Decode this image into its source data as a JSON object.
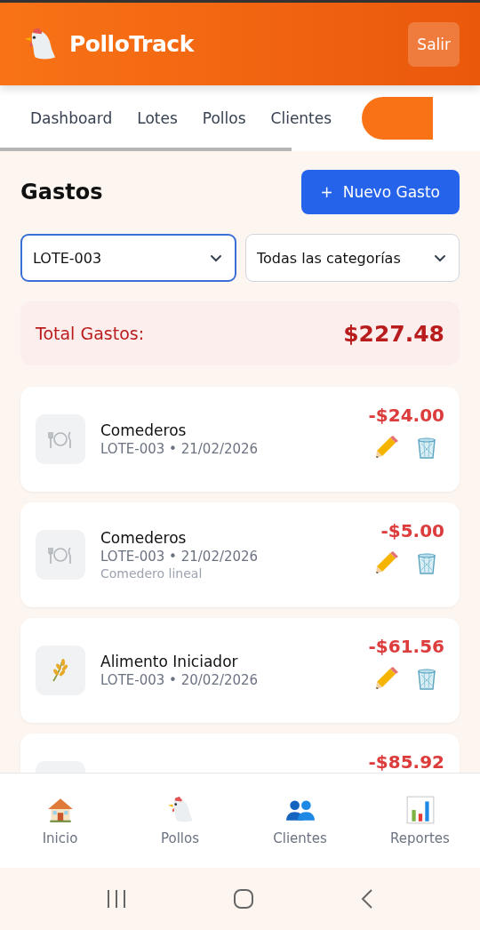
{
  "header": {
    "title": "PolloTrack",
    "logout": "Salir"
  },
  "tabs": [
    {
      "label": "Dashboard",
      "selected": false
    },
    {
      "label": "Lotes",
      "selected": false
    },
    {
      "label": "Pollos",
      "selected": false
    },
    {
      "label": "Clientes",
      "selected": false
    },
    {
      "selected": true
    }
  ],
  "page": {
    "title": "Gastos",
    "new_button": "+  Nuevo Gasto"
  },
  "filters": [
    {
      "value": "LOTE-003",
      "focused": true
    },
    {
      "value": "Todas las categorías",
      "focused": false
    }
  ],
  "total": {
    "label": "Total Gastos:",
    "value": "$227.48"
  },
  "expenses": [
    {
      "kind": "utensils",
      "name": "Comederos",
      "meta": "LOTE-003 • 21/02/2026",
      "amount": "-$24.00"
    },
    {
      "kind": "utensils",
      "name": "Comederos",
      "meta": "LOTE-003 • 21/02/2026",
      "note": "Comedero lineal",
      "amount": "-$5.00"
    },
    {
      "kind": "grain",
      "name": "Alimento Iniciador",
      "meta": "LOTE-003 • 20/02/2026",
      "amount": "-$61.56"
    },
    {
      "amount": "-$85.92"
    }
  ],
  "bottom_nav": [
    {
      "kind": "house",
      "label": "Inicio"
    },
    {
      "kind": "chicken",
      "label": "Pollos"
    },
    {
      "kind": "people",
      "label": "Clientes"
    },
    {
      "kind": "chart",
      "label": "Reportes"
    }
  ]
}
